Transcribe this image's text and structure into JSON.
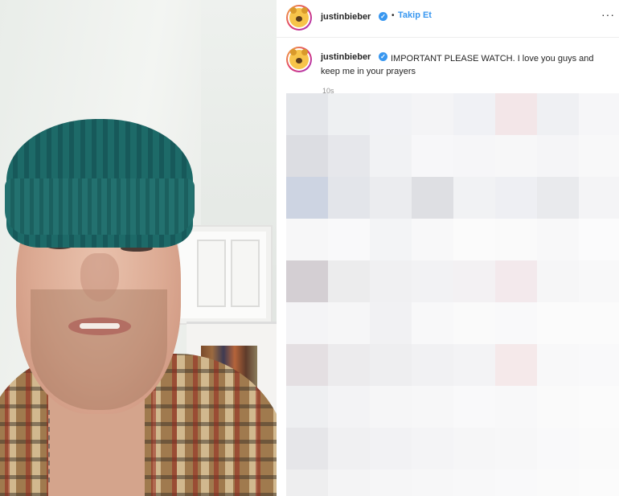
{
  "header": {
    "username": "justinbieber",
    "verified_icon": "verified-badge-icon",
    "separator": "•",
    "follow_label": "Takip Et",
    "more_icon": "more-options-icon",
    "more_label": "···"
  },
  "caption": {
    "username": "justinbieber",
    "text": "IMPORTANT PLEASE WATCH. I love you guys and keep me in your prayers",
    "time": "10s"
  },
  "colors": {
    "accent": "#3897f0",
    "text": "#262626",
    "muted": "#8e8e8e"
  },
  "mosaic": {
    "tiles": [
      "#e4e6ea",
      "#eef0f2",
      "#f1f2f5",
      "#f4f4f6",
      "#f0f1f5",
      "#f3e6e8",
      "#eff0f3",
      "#f6f6f8",
      "#dcdde2",
      "#e6e7eb",
      "#f1f2f4",
      "#f7f7f9",
      "#f6f6f8",
      "#f7f7f8",
      "#f5f5f7",
      "#f8f8f9",
      "#cdd4e2",
      "#e3e5ea",
      "#ebecef",
      "#dedfe3",
      "#f1f2f4",
      "#eeeff3",
      "#e9eaed",
      "#f4f4f6",
      "#f7f7f8",
      "#f9f9fa",
      "#f3f4f6",
      "#f8f8f9",
      "#fbfbfb",
      "#fafafa",
      "#f8f8f9",
      "#fbfbfc",
      "#d4cfd3",
      "#ececed",
      "#f0f0f2",
      "#f2f2f4",
      "#f3f1f3",
      "#f3e9ec",
      "#f6f6f7",
      "#f8f8f9",
      "#f4f4f6",
      "#f6f6f7",
      "#f1f1f3",
      "#f8f8f9",
      "#fafafa",
      "#f9f9fa",
      "#fbfbfb",
      "#fbfbfb",
      "#e4dfe2",
      "#ecebed",
      "#eeeef0",
      "#f1f1f3",
      "#f3f3f5",
      "#f5e9ea",
      "#f8f8f9",
      "#f9f9fa",
      "#eeeff1",
      "#f3f3f5",
      "#f6f6f7",
      "#f7f7f8",
      "#f9f9fa",
      "#f8f8f9",
      "#fafafa",
      "#fbfbfb",
      "#e6e6e9",
      "#f0f0f2",
      "#f2f2f4",
      "#f4f4f6",
      "#f6f6f7",
      "#f7f7f8",
      "#f9f9fa",
      "#fafafa",
      "#eeeeef",
      "#f4f4f5",
      "#f6f6f7",
      "#f7f7f8",
      "#f8f8f9",
      "#f9f9fa",
      "#fafafa",
      "#fbfbfb"
    ]
  }
}
